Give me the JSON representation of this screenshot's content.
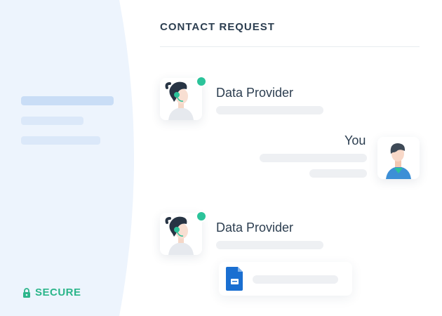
{
  "header": {
    "title": "CONTACT REQUEST"
  },
  "sidebar": {
    "secure_label": "SECURE"
  },
  "messages": [
    {
      "sender": "Data Provider",
      "avatar": "support-agent-avatar",
      "online": true
    },
    {
      "sender": "You",
      "avatar": "user-avatar"
    },
    {
      "sender": "Data Provider",
      "avatar": "support-agent-avatar",
      "online": true,
      "attachment": "document-icon"
    }
  ],
  "colors": {
    "accent_green": "#2bc39a",
    "secure_green": "#2bb58a",
    "panel_bg": "#edf4fd",
    "doc_blue": "#1a6fd1"
  }
}
